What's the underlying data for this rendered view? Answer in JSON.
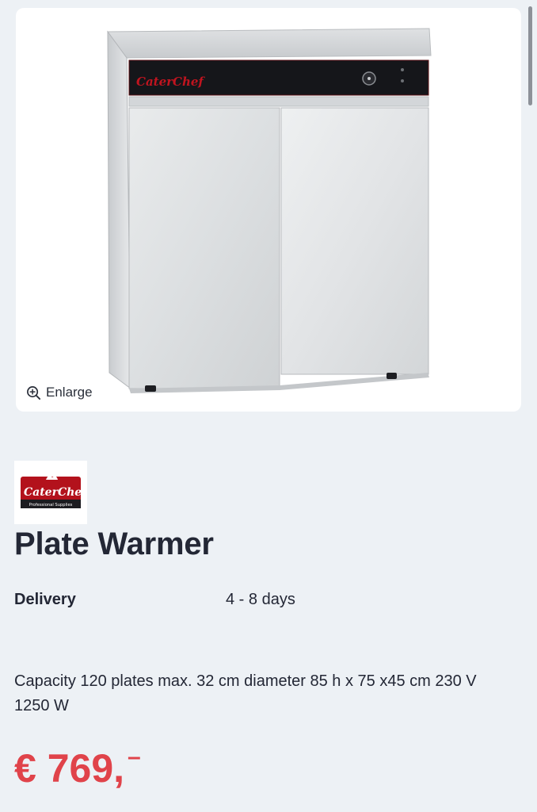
{
  "gallery": {
    "enlarge_label": "Enlarge",
    "brand_on_product": "CaterChef"
  },
  "brand": {
    "logo_text": "CaterChef",
    "tagline": "Professional Supplies"
  },
  "product": {
    "title": "Plate Warmer",
    "delivery_label": "Delivery",
    "delivery_value": "4 - 8 days",
    "description": "Capacity 120 plates max. 32 cm diameter 85 h x 75 x45 cm 230 V 1250 W",
    "price_main": "€ 769,",
    "price_suffix": "–"
  },
  "colors": {
    "page_background": "#edf1f5",
    "price": "#e0434a",
    "brand_red": "#b3121c"
  }
}
